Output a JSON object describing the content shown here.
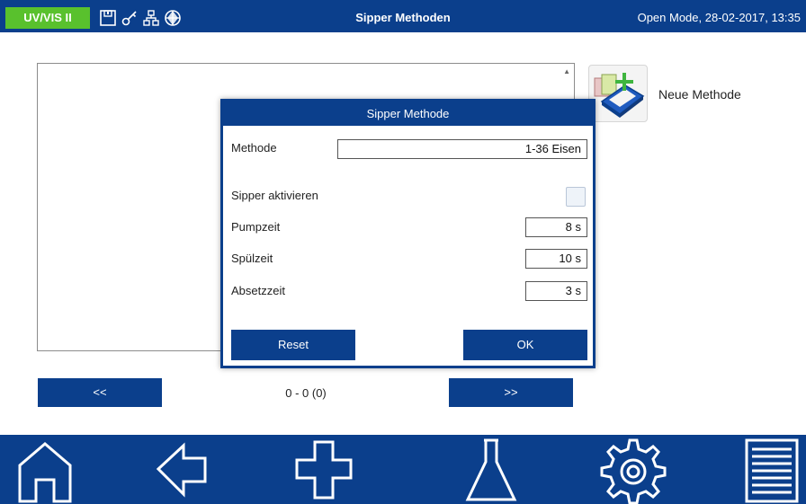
{
  "topbar": {
    "device": "UV/VIS II",
    "title": "Sipper Methoden",
    "mode": "Open Mode, 28-02-2017, 13:35",
    "status_icons": [
      "save-icon",
      "key-icon",
      "network-icon",
      "globe-icon"
    ]
  },
  "side": {
    "new_method_label": "Neue Methode",
    "new_method_icon": "add-method-icon"
  },
  "pager": {
    "prev_label": "<<",
    "next_label": ">>",
    "info": "0 - 0 (0)"
  },
  "dialog": {
    "title": "Sipper Methode",
    "method_label": "Methode",
    "method_value": "1-36 Eisen",
    "sipper_label": "Sipper aktivieren",
    "sipper_checked": false,
    "pump_label": "Pumpzeit",
    "pump_value": "8 s",
    "rinse_label": "Spülzeit",
    "rinse_value": "10 s",
    "settle_label": "Absetzzeit",
    "settle_value": "3 s",
    "reset_label": "Reset",
    "ok_label": "OK"
  },
  "bottom_nav": [
    "home-icon",
    "back-icon",
    "add-icon",
    "flask-icon",
    "settings-icon",
    "list-icon"
  ],
  "colors": {
    "primary": "#0b3f8c",
    "accent": "#59c12d"
  }
}
